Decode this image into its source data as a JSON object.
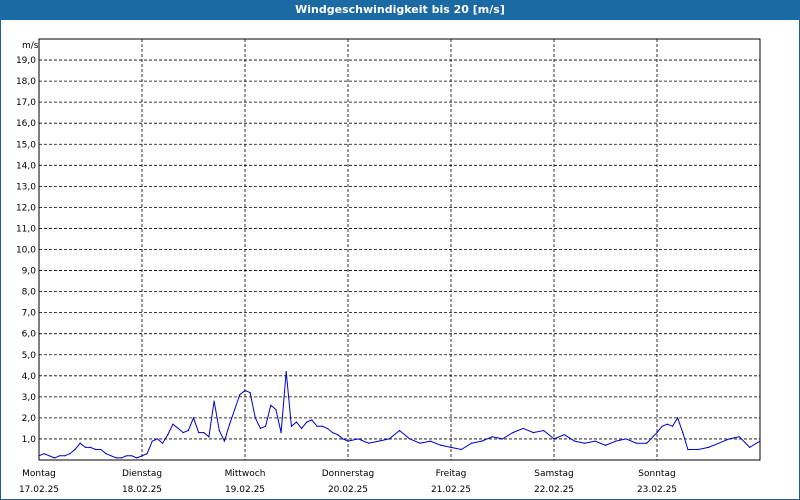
{
  "window": {
    "title": "Windgeschwindigkeit bis 20 [m/s]"
  },
  "chart_data": {
    "type": "line",
    "unit_label": "m/s",
    "ylim": [
      0,
      20
    ],
    "y_ticks": [
      "1,0",
      "2,0",
      "3,0",
      "4,0",
      "5,0",
      "6,0",
      "7,0",
      "8,0",
      "9,0",
      "10,0",
      "11,0",
      "12,0",
      "13,0",
      "14,0",
      "15,0",
      "16,0",
      "17,0",
      "18,0",
      "19,0"
    ],
    "grid": true,
    "x_days": [
      {
        "day": "Montag",
        "date": "17.02.25"
      },
      {
        "day": "Dienstag",
        "date": "18.02.25"
      },
      {
        "day": "Mittwoch",
        "date": "19.02.25"
      },
      {
        "day": "Donnerstag",
        "date": "20.02.25"
      },
      {
        "day": "Freitag",
        "date": "21.02.25"
      },
      {
        "day": "Samstag",
        "date": "22.02.25"
      },
      {
        "day": "Sonntag",
        "date": "23.02.25"
      }
    ],
    "xlim": [
      0,
      7
    ],
    "series": [
      {
        "color": "#0000cc",
        "x": [
          0.0,
          0.05,
          0.1,
          0.15,
          0.2,
          0.25,
          0.3,
          0.35,
          0.4,
          0.45,
          0.5,
          0.55,
          0.6,
          0.65,
          0.7,
          0.75,
          0.8,
          0.85,
          0.9,
          0.95,
          1.0,
          1.05,
          1.1,
          1.15,
          1.2,
          1.25,
          1.3,
          1.35,
          1.4,
          1.45,
          1.5,
          1.55,
          1.6,
          1.65,
          1.7,
          1.75,
          1.8,
          1.85,
          1.9,
          1.95,
          2.0,
          2.05,
          2.1,
          2.15,
          2.2,
          2.25,
          2.3,
          2.35,
          2.4,
          2.45,
          2.5,
          2.55,
          2.6,
          2.65,
          2.7,
          2.75,
          2.8,
          2.85,
          2.9,
          2.95,
          3.0,
          3.1,
          3.2,
          3.3,
          3.4,
          3.5,
          3.6,
          3.7,
          3.8,
          3.9,
          4.0,
          4.1,
          4.2,
          4.3,
          4.4,
          4.5,
          4.6,
          4.7,
          4.8,
          4.9,
          5.0,
          5.1,
          5.2,
          5.3,
          5.4,
          5.5,
          5.6,
          5.7,
          5.8,
          5.9,
          6.0,
          6.05,
          6.1,
          6.15,
          6.2,
          6.25,
          6.3,
          6.4,
          6.5,
          6.6,
          6.7,
          6.8,
          6.9,
          7.0
        ],
        "y": [
          0.2,
          0.3,
          0.2,
          0.1,
          0.2,
          0.2,
          0.3,
          0.5,
          0.8,
          0.6,
          0.6,
          0.5,
          0.5,
          0.3,
          0.2,
          0.1,
          0.1,
          0.2,
          0.2,
          0.1,
          0.2,
          0.3,
          0.9,
          1.0,
          0.8,
          1.2,
          1.7,
          1.5,
          1.3,
          1.4,
          2.0,
          1.3,
          1.3,
          1.1,
          2.8,
          1.4,
          0.9,
          1.7,
          2.4,
          3.1,
          3.3,
          3.2,
          2.0,
          1.5,
          1.6,
          2.6,
          2.4,
          1.3,
          4.2,
          1.6,
          1.8,
          1.5,
          1.8,
          1.9,
          1.6,
          1.6,
          1.5,
          1.3,
          1.2,
          1.0,
          0.9,
          1.0,
          0.8,
          0.9,
          1.0,
          1.4,
          1.0,
          0.8,
          0.9,
          0.7,
          0.6,
          0.5,
          0.8,
          0.9,
          1.1,
          1.0,
          1.3,
          1.5,
          1.3,
          1.4,
          1.0,
          1.2,
          0.9,
          0.8,
          0.9,
          0.7,
          0.9,
          1.0,
          0.8,
          0.8,
          1.3,
          1.6,
          1.7,
          1.6,
          2.0,
          1.3,
          0.5,
          0.5,
          0.6,
          0.8,
          1.0,
          1.1,
          0.6,
          0.9
        ]
      }
    ]
  }
}
